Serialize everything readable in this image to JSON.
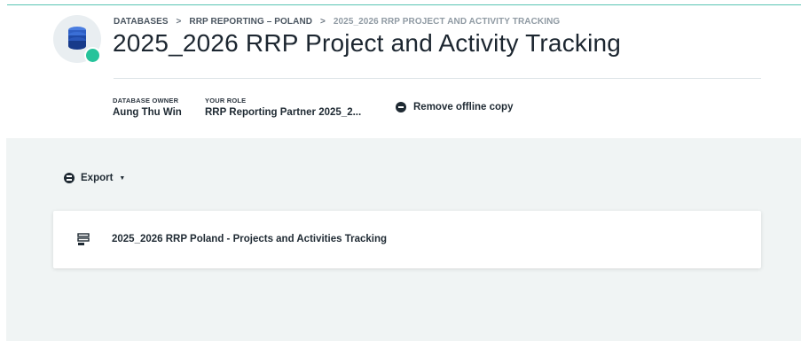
{
  "header": {
    "breadcrumb": [
      {
        "label": "DATABASES"
      },
      {
        "label": "RRP REPORTING – POLAND"
      },
      {
        "label": "2025_2026 RRP PROJECT AND ACTIVITY TRACKING"
      }
    ],
    "breadcrumb_separator": ">",
    "title": "2025_2026 RRP Project and Activity Tracking",
    "database_icon": "database-icon",
    "status_dot_color": "#26c39b",
    "owner": {
      "label": "DATABASE OWNER",
      "value": "Aung Thu Win"
    },
    "role": {
      "label": "YOUR ROLE",
      "value": "RRP Reporting Partner 2025_2..."
    },
    "offline_action": {
      "label": "Remove offline copy",
      "icon": "minus-circle-icon"
    }
  },
  "toolbar": {
    "export_label": "Export",
    "export_icon": "export-icon",
    "export_caret": "▼"
  },
  "forms": [
    {
      "name": "2025_2026 RRP Poland - Projects and Activities Tracking",
      "icon": "form-icon"
    }
  ],
  "colors": {
    "accent": "#5ac4b4",
    "content_background": "#f0f4f4",
    "text": "#1f2a33"
  }
}
